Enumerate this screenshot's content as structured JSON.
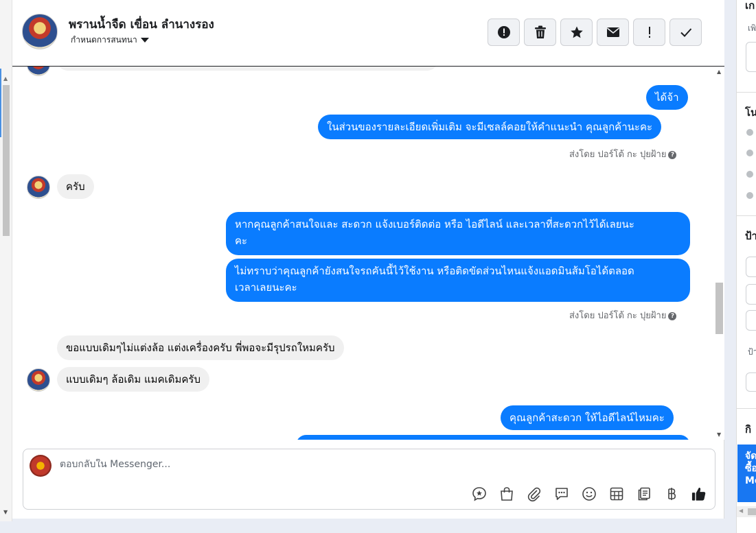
{
  "header": {
    "name": "พรานน้ำจืด เขื่อน ลำนางรอง",
    "subtitle": "กำหนดการสนทนา"
  },
  "actions": [
    {
      "name": "spam-icon",
      "glyph": "!"
    },
    {
      "name": "trash-icon",
      "glyph": "🗑"
    },
    {
      "name": "star-icon",
      "glyph": "★"
    },
    {
      "name": "mail-icon",
      "glyph": "✉"
    },
    {
      "name": "exclamation-icon",
      "glyph": "!"
    },
    {
      "name": "check-icon",
      "glyph": "✓"
    }
  ],
  "messages": {
    "m1": "ได้จ้า",
    "m2": "ในส่วนของรายละเอียดเพิ่มเติม จะมีเซลล์คอยให้คำแนะนำ คุณลูกค้านะคะ",
    "sent_by_1": "ส่งโดย ปอร์โต้ กะ ปุยฝ้าย",
    "m3": "ครับ",
    "m4_line1": "หากคุณลูกค้าสนใจและ สะดวก แจ้งเบอร์ติดต่อ หรือ ไอดีไลน์ และเวลาที่สะดวกไว้ได้เลยนะ",
    "m4_line2": "คะ",
    "m5_line1": "ไม่ทราบว่าคุณลูกค้ายังสนใจรถคันนี้ไว้ใช้งาน หรือติดขัดส่วนไหนแจ้งแอดมินส้มโอได้ตลอด",
    "m5_line2": "เวลาเลยนะคะ",
    "sent_by_2": "ส่งโดย ปอร์โต้ กะ ปุยฝ้าย",
    "m6": "ขอแบบเดิมๆไม่แต่งล้อ  แต่งเครื่องครับ  พี่พอจะมีรุปรถใหมครับ",
    "m7": "แบบเดิมๆ ล้อเดิม  แมคเดิมครับ",
    "m8": "คุณลูกค้าสะดวก ให้ไอดีไลน์ไหมคะ"
  },
  "composer": {
    "placeholder": "ตอบกลับใน Messenger..."
  },
  "right_panel": {
    "text_top": "เก",
    "text_small_1": "เพิ",
    "section_2": "โน",
    "section_3": "ป้า",
    "text_small_2": "ป้า",
    "section_4": "กิ",
    "blue_line1": "จัด",
    "blue_line2": "ซื้อ",
    "blue_line3": "Mo"
  }
}
